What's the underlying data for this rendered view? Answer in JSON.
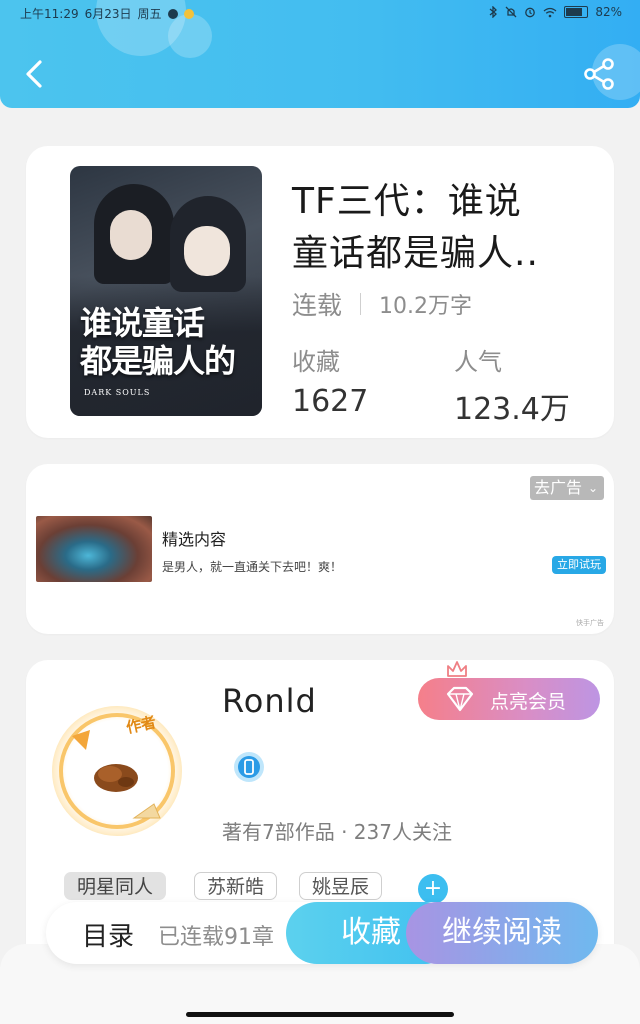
{
  "status_bar": {
    "time": "上午11:29",
    "date": "6月23日",
    "weekday": "周五",
    "battery": "82%"
  },
  "header": {
    "back_icon": "chevron-left-icon",
    "share_icon": "share-icon",
    "gradient_start": "#4cc4ee",
    "gradient_end": "#33aef3"
  },
  "book": {
    "title_line1": "TF三代：谁说",
    "title_line2": "童话都是骗人..",
    "status": "连载",
    "word_count": "10.2万字",
    "favorites_label": "收藏",
    "favorites_value": "1627",
    "popularity_label": "人气",
    "popularity_value": "123.4万",
    "cover": {
      "title_line1": "谁说童话",
      "title_line2": "都是骗人的",
      "subtitle": "DARK SOULS"
    }
  },
  "ad": {
    "remove_label": "去广告",
    "title": "精选内容",
    "description": "是男人，就一直通关下去吧！爽！",
    "cta": "立即试玩",
    "source": "快手广告"
  },
  "author": {
    "badge": "作者",
    "name": "Ronld",
    "vip_button": "点亮会员",
    "works_info": "著有7部作品 · 237人关注",
    "tags": [
      "明星同人",
      "苏新皓",
      "姚昱辰"
    ],
    "add_tag": "+"
  },
  "bottom_bar": {
    "catalog": "目录",
    "chapters": "已连载91章",
    "collect": "收藏",
    "continue_reading": "继续阅读"
  }
}
